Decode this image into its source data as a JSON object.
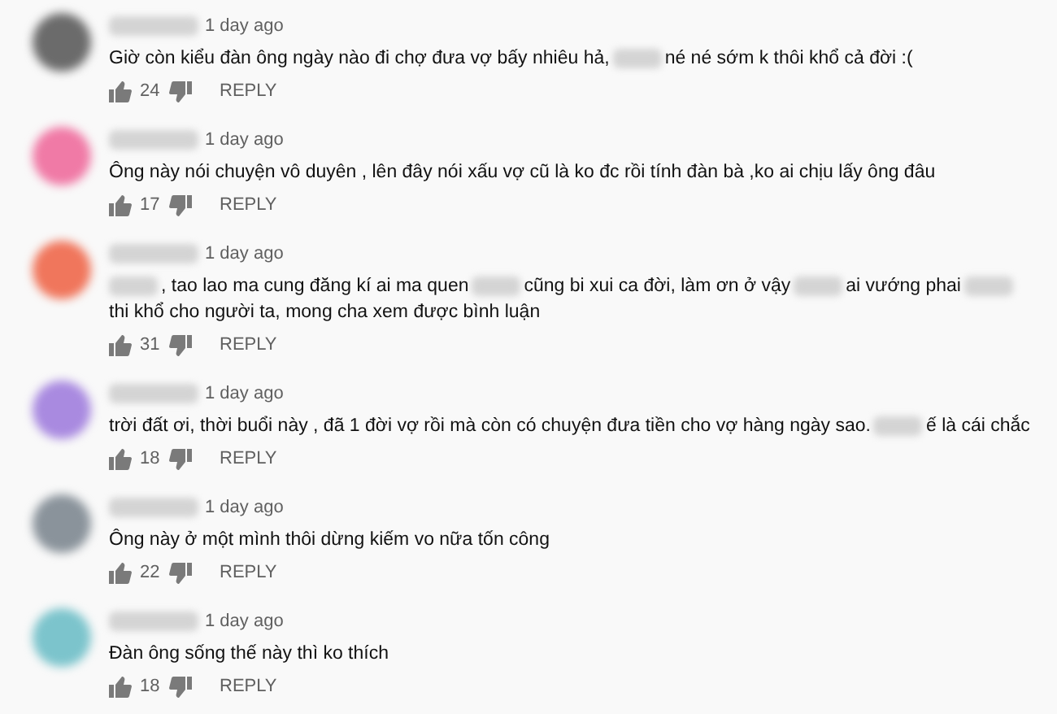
{
  "comments": [
    {
      "color": "#6b6b6b",
      "time": "1 day ago",
      "body": [
        {
          "kind": "text",
          "text": "Giờ còn kiểu đàn ông ngày nào đi chợ đưa vợ bấy nhiêu hả,"
        },
        {
          "kind": "redacted"
        },
        {
          "kind": "text",
          "text": "né né sớm k thôi khổ cả đời :("
        }
      ],
      "likes": "24",
      "reply": "REPLY"
    },
    {
      "color": "#f07aa6",
      "time": "1 day ago",
      "body": [
        {
          "kind": "text",
          "text": "Ông này nói chuyện vô duyên , lên đây nói xấu vợ cũ là ko đc rồi tính đàn bà ,ko ai chịu lấy ông đâu"
        }
      ],
      "likes": "17",
      "reply": "REPLY"
    },
    {
      "color": "#f0765c",
      "time": "1 day ago",
      "body": [
        {
          "kind": "redacted"
        },
        {
          "kind": "text",
          "text": ", tao lao ma cung đăng kí ai ma quen"
        },
        {
          "kind": "redacted"
        },
        {
          "kind": "text",
          "text": "cũng bi xui ca đời,  làm ơn ở vậy"
        },
        {
          "kind": "redacted"
        },
        {
          "kind": "text",
          "text": "ai vướng phai"
        },
        {
          "kind": "redacted"
        },
        {
          "kind": "text",
          "text": "thi khổ cho người ta, mong cha xem được bình luận"
        }
      ],
      "likes": "31",
      "reply": "REPLY"
    },
    {
      "color": "#a98ae0",
      "time": "1 day ago",
      "body": [
        {
          "kind": "text",
          "text": "trời đất ơi, thời buổi này , đã 1 đời vợ rồi mà còn có chuyện đưa tiền cho vợ hàng ngày sao."
        },
        {
          "kind": "redacted"
        },
        {
          "kind": "text",
          "text": "ế là cái chắc"
        }
      ],
      "likes": "18",
      "reply": "REPLY"
    },
    {
      "color": "#8a939b",
      "time": "1 day ago",
      "body": [
        {
          "kind": "text",
          "text": "Ông này ở một mình thôi dừng kiếm vo nữa tốn công"
        }
      ],
      "likes": "22",
      "reply": "REPLY"
    },
    {
      "color": "#7cc4cc",
      "time": "1 day ago",
      "body": [
        {
          "kind": "text",
          "text": "Đàn ông sống thế này thì ko thích"
        }
      ],
      "likes": "18",
      "reply": "REPLY"
    }
  ]
}
